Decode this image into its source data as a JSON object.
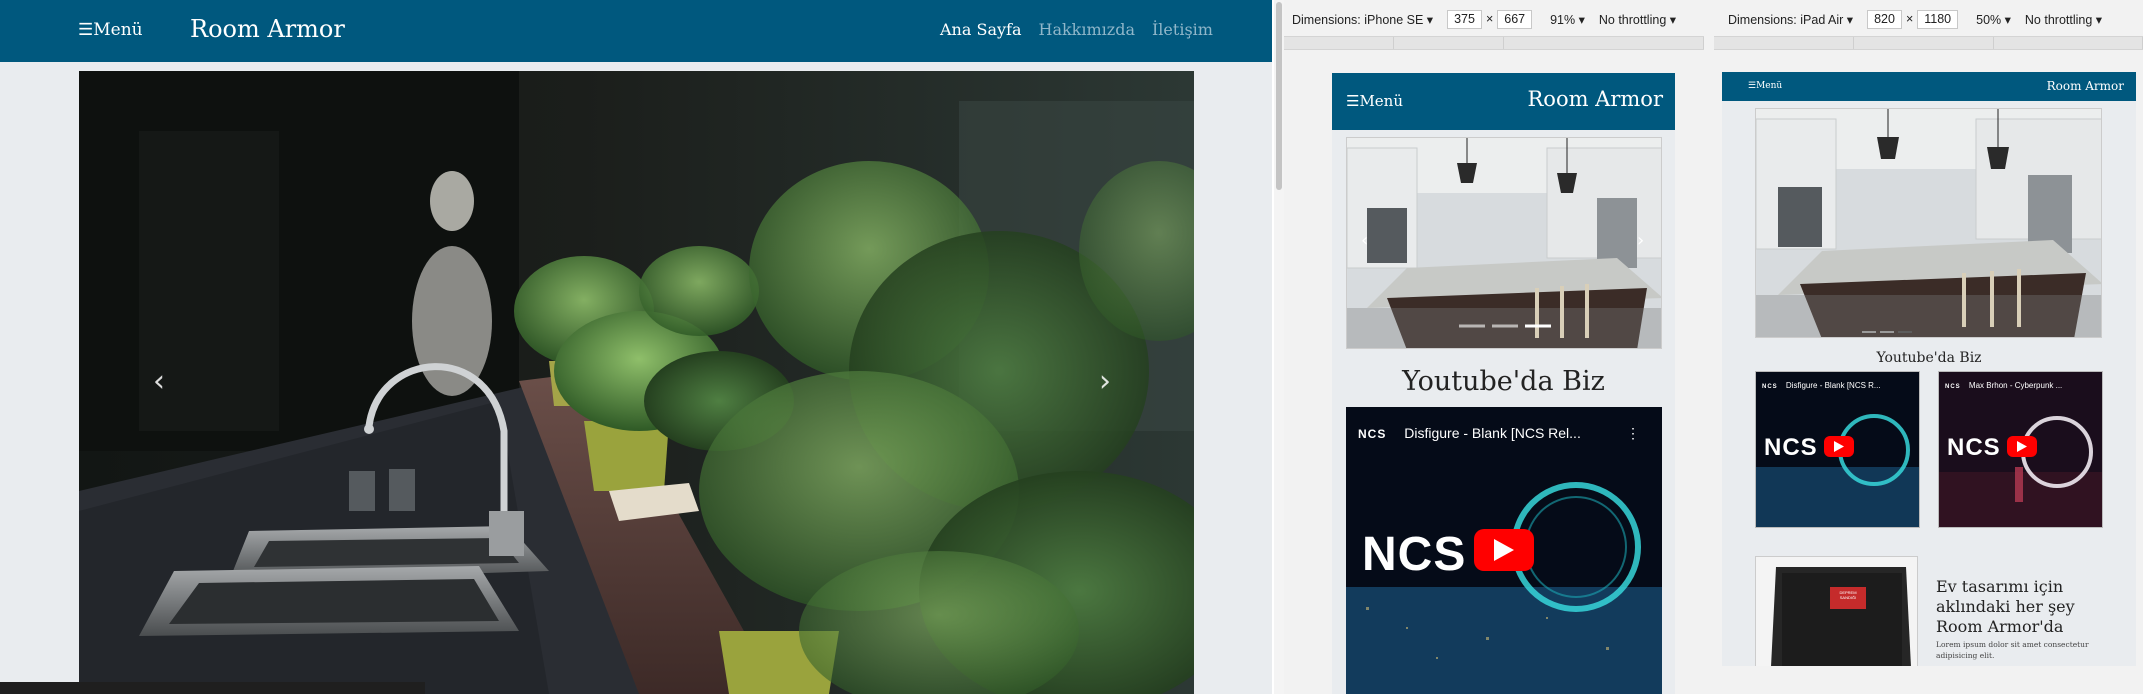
{
  "site": {
    "brand": "Room Armor",
    "menu_label": "☰Menü",
    "nav_links": [
      "Ana Sayfa",
      "Hakkımızda",
      "İletişim"
    ],
    "active_link": "Ana Sayfa"
  },
  "carousel": {
    "prev_icon": "chevron-left-icon",
    "next_icon": "chevron-right-icon"
  },
  "devtools": {
    "phone": {
      "device_label": "Dimensions: iPhone SE ▾",
      "width": "375",
      "times": "×",
      "height": "667",
      "zoom": "91% ▾",
      "throttle": "No throttling ▾"
    },
    "ipad": {
      "device_label": "Dimensions: iPad Air ▾",
      "width": "820",
      "times": "×",
      "height": "1180",
      "zoom": "50% ▾",
      "throttle": "No throttling ▾"
    }
  },
  "mobile": {
    "section_heading": "Youtube'da Biz",
    "video1_title": "Disfigure - Blank [NCS Rel...",
    "ncs_logo": "NCS"
  },
  "tablet": {
    "section_heading": "Youtube'da Biz",
    "video1_title": "Disfigure - Blank [NCS R...",
    "video2_title": "Max Brhon - Cyberpunk ...",
    "card_title": "Ev tasarımı için aklındaki her şey Room Armor'da",
    "card_text": "Lorem ipsum dolor sit amet consectetur adipisicing elit.",
    "card_badge": "DEPREM SANDIĞI",
    "ncs_logo": "NCS"
  },
  "colors": {
    "navbar": "#00587e",
    "page_bg": "#e9ecef",
    "youtube_red": "#ff0000"
  }
}
